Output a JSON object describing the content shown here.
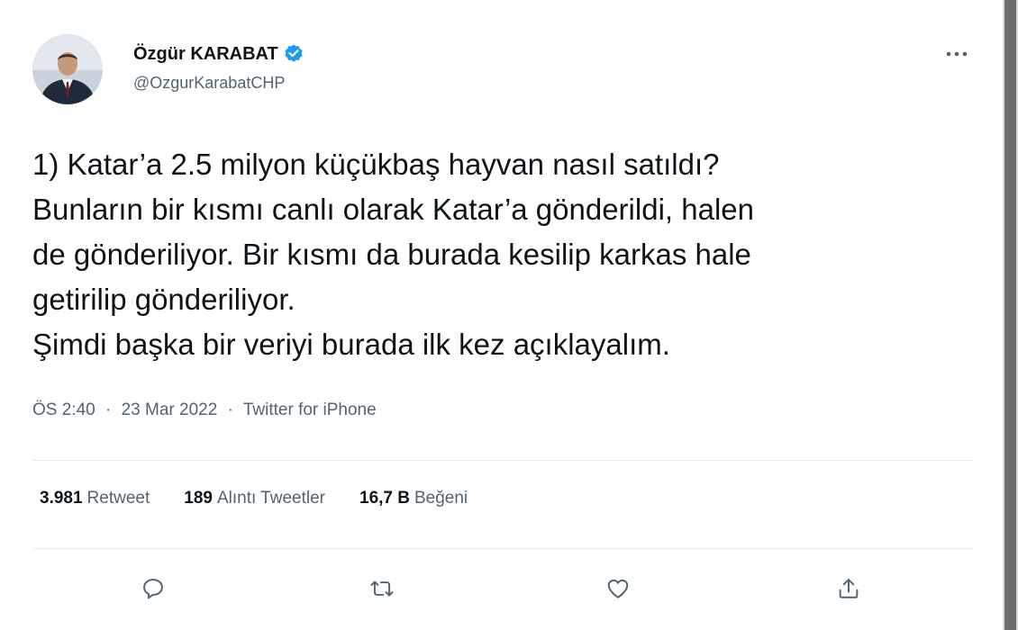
{
  "author": {
    "name": "Özgür KARABAT",
    "handle": "@OzgurKarabatCHP",
    "verified": true
  },
  "tweet": {
    "lines": [
      "1) Katar’a 2.5 milyon küçükbaş hayvan nasıl satıldı?",
      "Bunların bir kısmı canlı olarak Katar’a gönderildi, halen",
      "de gönderiliyor. Bir kısmı da burada kesilip karkas hale",
      "getirilip gönderiliyor.",
      "Şimdi başka bir veriyi burada ilk kez açıklayalım."
    ]
  },
  "meta": {
    "time": "ÖS 2:40",
    "separator": "·",
    "date": "23 Mar 2022",
    "source": "Twitter for iPhone"
  },
  "stats": {
    "retweets": {
      "count": "3.981",
      "label": "Retweet"
    },
    "quotes": {
      "count": "189",
      "label": "Alıntı Tweetler"
    },
    "likes": {
      "count": "16,7 B",
      "label": "Beğeni"
    }
  },
  "icons": {
    "more": "more-dots-icon",
    "reply": "reply-icon",
    "retweet": "retweet-icon",
    "like": "heart-icon",
    "share": "share-icon",
    "verified": "verified-badge-icon"
  },
  "colors": {
    "verified": "#1d9bf0",
    "text": "#0f1419",
    "secondary": "#536471",
    "divider": "#e6ecf0"
  }
}
